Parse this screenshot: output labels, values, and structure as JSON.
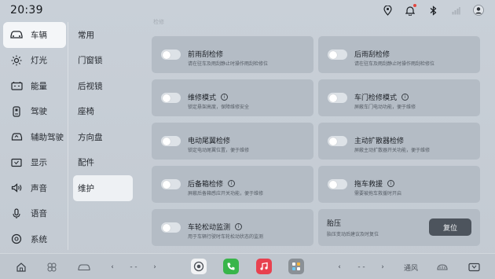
{
  "status_bar": {
    "time": "20:39",
    "icons": [
      "location-icon",
      "notification-icon",
      "bluetooth-icon",
      "signal-icon",
      "user-avatar-icon"
    ]
  },
  "nav_primary": {
    "items": [
      {
        "label": "车辆",
        "icon": "car-icon",
        "active": true
      },
      {
        "label": "灯光",
        "icon": "light-icon",
        "active": false
      },
      {
        "label": "能量",
        "icon": "battery-icon",
        "active": false
      },
      {
        "label": "驾驶",
        "icon": "drive-icon",
        "active": false
      },
      {
        "label": "辅助驾驶",
        "icon": "assist-drive-icon",
        "active": false
      },
      {
        "label": "显示",
        "icon": "display-icon",
        "active": false
      },
      {
        "label": "声音",
        "icon": "sound-icon",
        "active": false
      },
      {
        "label": "语音",
        "icon": "voice-icon",
        "active": false
      },
      {
        "label": "系统",
        "icon": "system-icon",
        "active": false
      }
    ]
  },
  "nav_secondary": {
    "items": [
      {
        "label": "常用",
        "active": false
      },
      {
        "label": "门窗锁",
        "active": false
      },
      {
        "label": "后视镜",
        "active": false
      },
      {
        "label": "座椅",
        "active": false
      },
      {
        "label": "方向盘",
        "active": false
      },
      {
        "label": "配件",
        "active": false
      },
      {
        "label": "维护",
        "active": true
      }
    ]
  },
  "main": {
    "section_label": "检修",
    "cards": [
      {
        "title": "前雨刮检修",
        "desc": "请在驻车及雨刮静止时操作雨刮检修位",
        "info": false,
        "toggle_on": false
      },
      {
        "title": "后雨刮检修",
        "desc": "请在驻车及雨刮静止时操作雨刮检修位",
        "info": false,
        "toggle_on": false
      },
      {
        "title": "维修模式",
        "desc": "锁定悬架高度，保障维修安全",
        "info": true,
        "toggle_on": false
      },
      {
        "title": "车门检修模式",
        "desc": "屏蔽车门电动功能，便于维修",
        "info": true,
        "toggle_on": false
      },
      {
        "title": "电动尾翼检修",
        "desc": "锁定电动尾翼位置，便于维修",
        "info": false,
        "toggle_on": false
      },
      {
        "title": "主动扩散器检修",
        "desc": "屏蔽主动扩散器开关功能，便于维修",
        "info": false,
        "toggle_on": false
      },
      {
        "title": "后备箱检修",
        "desc": "屏蔽后备箱感应开关功能，便于维修",
        "info": true,
        "toggle_on": false
      },
      {
        "title": "拖车救援",
        "desc": "需要被拖车救援时开启",
        "info": true,
        "toggle_on": false
      },
      {
        "title": "车轮松动监测",
        "desc": "用于车辆行驶时车轮松动状态的监测",
        "info": true,
        "toggle_on": false
      }
    ],
    "tire_card": {
      "title": "胎压",
      "desc": "胎压变动后建议及时复位",
      "button_label": "复位"
    },
    "info_glyph": "i"
  },
  "dock": {
    "nav_left": "‹",
    "dash_left": "- -",
    "nav_right": "›",
    "nav_left2": "‹",
    "dash_right": "- -",
    "nav_right2": "›",
    "fan_label": "通风",
    "apps": [
      "camera-app-icon",
      "phone-app-icon",
      "music-app-icon",
      "apps-grid-icon"
    ]
  }
}
